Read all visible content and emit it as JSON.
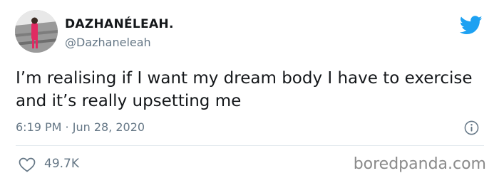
{
  "user": {
    "display_name": "DAZHANÉLEAH.",
    "handle": "@Dazhaneleah"
  },
  "tweet": {
    "text": "I’m realising if I want my dream body I have to exercise and it’s really upsetting me",
    "timestamp": "6:19 PM · Jun 28, 2020",
    "likes": "49.7K"
  },
  "watermark": "boredpanda.com",
  "icons": {
    "brand": "twitter-bird-icon",
    "info": "info-icon",
    "like": "heart-icon"
  },
  "colors": {
    "twitter_blue": "#1da1f2",
    "secondary_text": "#657786",
    "divider": "#e1e8ed"
  }
}
